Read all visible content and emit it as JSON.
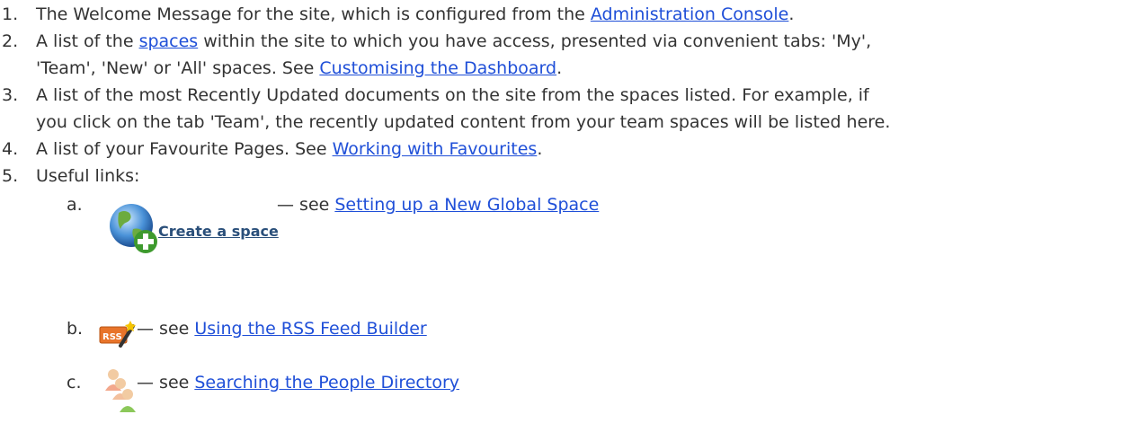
{
  "items": [
    {
      "num": "1.",
      "before": "The Welcome Message for the site, which is configured from the ",
      "link": "Administration Console",
      "after": "."
    },
    {
      "num": "2.",
      "line1_before": "A list of the ",
      "line1_link": "spaces",
      "line1_after": " within the site to which you have access, presented via convenient tabs: 'My',",
      "line2_before": "'Team', 'New' or 'All' spaces. See ",
      "line2_link": "Customising the Dashboard",
      "line2_after": "."
    },
    {
      "num": "3.",
      "line1": "A list of the most Recently Updated documents on the site from the spaces listed. For example, if",
      "line2": "you click on the tab 'Team', the recently updated content from your team spaces will be listed here."
    },
    {
      "num": "4.",
      "before": "A list of your Favourite Pages. See ",
      "link": "Working with Favourites",
      "after": "."
    },
    {
      "num": "5.",
      "text": "Useful links:"
    }
  ],
  "useful_links": [
    {
      "letter": "a.",
      "icon": "globe-add-icon",
      "icon_text": "Create a space",
      "see": " — see ",
      "link": "Setting up a New Global Space"
    },
    {
      "letter": "b.",
      "icon": "rss-builder-icon",
      "icon_text": "RSS",
      "see": " — see ",
      "link": "Using the RSS Feed Builder"
    },
    {
      "letter": "c.",
      "icon": "people-icon",
      "see": " — see ",
      "link": "Searching the People Directory"
    }
  ],
  "colors": {
    "link": "#1f4fd8",
    "text": "#333333"
  }
}
